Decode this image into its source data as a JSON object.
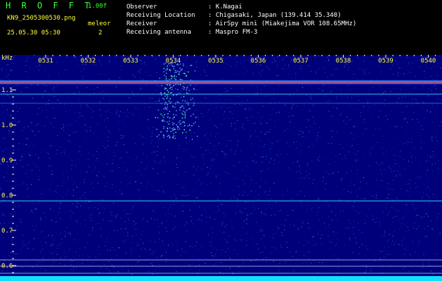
{
  "header": {
    "app_title": "H R O F F T",
    "version": "1.00f",
    "filename": "KN9_2505300530.png",
    "mode_label": "meleor",
    "datetime": "25.05.30 05:30",
    "mode_value": "2",
    "info": [
      {
        "label": "Observer",
        "value": ": K.Nagai"
      },
      {
        "label": "Receiving Location",
        "value": ": Chigasaki, Japan (139.414 35.340)"
      },
      {
        "label": "Receiver",
        "value": ": AirSpy mini (Miakejima VOR 108.65MHz)"
      },
      {
        "label": "Receiving antenna",
        "value": ": Maspro FM-3"
      }
    ]
  },
  "spectrogram": {
    "y_unit": "kHz",
    "y_ticks": [
      "1.1",
      "1.0",
      "0.9",
      "0.8",
      "0.7",
      "0.6"
    ],
    "x_ticks": [
      "0531",
      "0532",
      "0533",
      "0534",
      "0535",
      "0536",
      "0537",
      "0538",
      "0539",
      "0540"
    ],
    "colors": {
      "background": "#00007a",
      "text": "#ffff3c",
      "tick": "#ffffff"
    }
  }
}
